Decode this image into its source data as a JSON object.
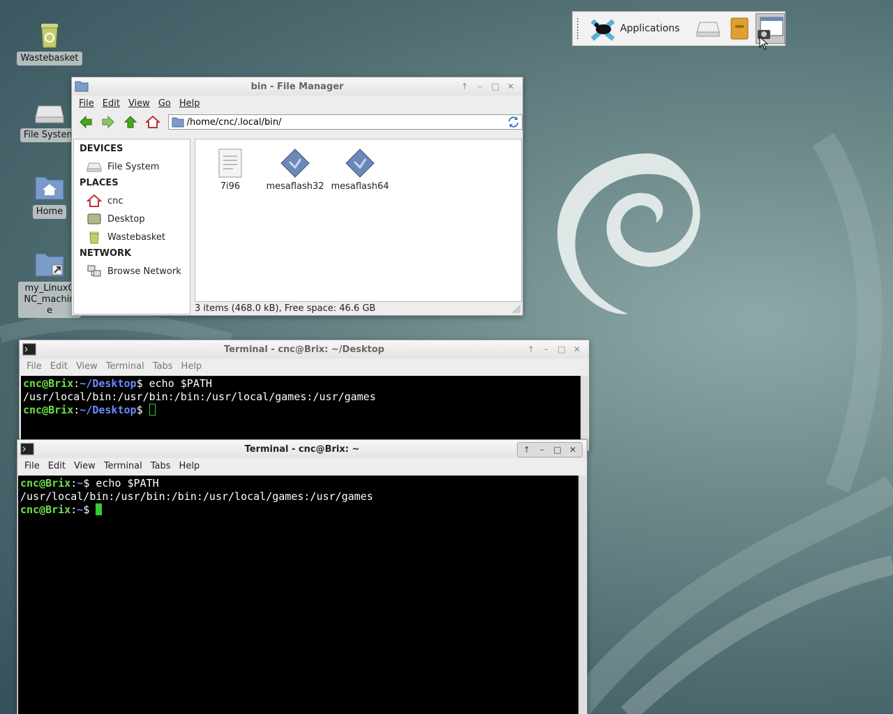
{
  "desktop": {
    "icons": [
      {
        "label": "Wastebasket"
      },
      {
        "label": "File System"
      },
      {
        "label": "Home"
      },
      {
        "label": "my_LinuxCNC_machine"
      }
    ]
  },
  "panel": {
    "applications_label": "Applications"
  },
  "file_manager": {
    "title": "bin - File Manager",
    "menu": [
      "File",
      "Edit",
      "View",
      "Go",
      "Help"
    ],
    "address": "/home/cnc/.local/bin/",
    "sidebar": {
      "devices_header": "DEVICES",
      "devices": [
        "File System"
      ],
      "places_header": "PLACES",
      "places": [
        "cnc",
        "Desktop",
        "Wastebasket"
      ],
      "network_header": "NETWORK",
      "network": [
        "Browse Network"
      ]
    },
    "files": [
      {
        "name": "7i96",
        "icon": "text-file-icon"
      },
      {
        "name": "mesaflash32",
        "icon": "executable-icon"
      },
      {
        "name": "mesaflash64",
        "icon": "executable-icon"
      }
    ],
    "status": "3 items (468.0 kB), Free space: 46.6 GB"
  },
  "terminal1": {
    "title": "Terminal - cnc@Brix: ~/Desktop",
    "menu": [
      "File",
      "Edit",
      "View",
      "Terminal",
      "Tabs",
      "Help"
    ],
    "user_host": "cnc@Brix",
    "path": "~/Desktop",
    "command": "echo $PATH",
    "output": "/usr/local/bin:/usr/bin:/bin:/usr/local/games:/usr/games"
  },
  "terminal2": {
    "title": "Terminal - cnc@Brix: ~",
    "menu": [
      "File",
      "Edit",
      "View",
      "Terminal",
      "Tabs",
      "Help"
    ],
    "user_host": "cnc@Brix",
    "path": "~",
    "command": "echo $PATH",
    "output": "/usr/local/bin:/usr/bin:/bin:/usr/local/games:/usr/games"
  },
  "colors": {
    "prompt_user": "#6ce24a",
    "prompt_path": "#6b8cff",
    "cursor": "#33cc33"
  }
}
